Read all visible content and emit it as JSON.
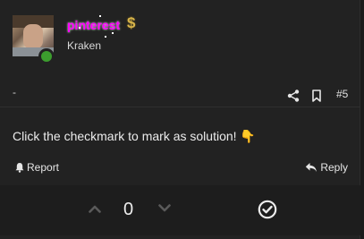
{
  "post": {
    "author": {
      "username": "pinterest",
      "title": "Kraken",
      "badge_symbol": "$",
      "online": true,
      "username_color": "#ff00ff"
    },
    "meta": {
      "dash": "-",
      "post_number": "#5"
    },
    "message": {
      "text": "Click the checkmark to mark as solution!",
      "emoji": "👇"
    },
    "actions": {
      "report_label": "Report",
      "reply_label": "Reply"
    },
    "votes": {
      "count": "0"
    }
  },
  "icons": {
    "share": "share-icon",
    "bookmark": "bookmark-icon",
    "report": "bell-icon",
    "reply": "reply-arrow-icon",
    "upvote": "chevron-up-icon",
    "downvote": "chevron-down-icon",
    "solution": "checkmark-circle-icon"
  }
}
